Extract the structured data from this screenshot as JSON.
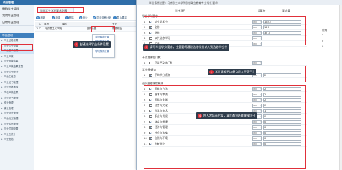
{
  "app": {
    "title": "毕业管理"
  },
  "sidebar": {
    "top": [
      "播教毕业管理",
      "我院毕业管理",
      "日常毕业管理"
    ],
    "section": "毕业管理",
    "items": [
      "毕业资格设置",
      "毕业学分设置",
      "毕业要求设置",
      "毕业审核",
      "毕业审核结果",
      "毕业审核结果查看",
      "毕业学分统计",
      "毕业生信息",
      "毕业证书管理",
      "学位资格审核",
      "学位审核结果",
      "学位证书管理",
      "结业管理",
      "肄业管理",
      "毕业设计管理",
      "毕业论文管理",
      "毕业成绩管理",
      "毕业学期设置",
      "毕业生统计",
      "毕业归档"
    ]
  },
  "main": {
    "tab": "毕业学生学分要求列表",
    "toolbar": [
      "刷新",
      "新增",
      "删除",
      "统计",
      "同步培养计划",
      "导入要求"
    ],
    "grid": {
      "headers": [
        "序号",
        "单位",
        "专业"
      ],
      "row": {
        "num": "1",
        "unit": "马克思主义学院",
        "action": "选择设置",
        "major": "思想政治"
      }
    },
    "context_menu": [
      "学分要求设置",
      "学分条件设置",
      "学分条件设置",
      "学分条件设置"
    ]
  },
  "dialog": {
    "title": "毕业条件设置：马克思主义学院思想政治教育专业 学分要求",
    "headers": [
      "毕业项目",
      "运算符",
      "要求值"
    ],
    "groups": [
      {
        "label": "学分学时要求",
        "rows": [
          {
            "idx": "1",
            "name": "毕业总学分",
            "op": ">=",
            "value": "164.5"
          },
          {
            "idx": "2",
            "name": "必修",
            "op": ">=",
            "value": "127"
          },
          {
            "idx": "3",
            "name": "选修",
            "op": ">=",
            "value": "37.5"
          },
          {
            "idx": "4",
            "name": "公共选修学分",
            "op": ">="
          },
          {
            "idx": "5",
            "name": "公选",
            "op": ">="
          }
        ]
      },
      {
        "label": "不及格课程门数",
        "rows": [
          {
            "idx": "1",
            "name": "正常不及格门数",
            "op": ">="
          }
        ]
      },
      {
        "label": "学分绩/绩点",
        "rows": [
          {
            "idx": "1",
            "name": "平均学分绩点",
            "op": ">=",
            "value": "2"
          }
        ]
      },
      {
        "label": "通识选修课程模块",
        "rows": [
          {
            "idx": "1",
            "name": "思维与方法",
            "op": ">=",
            "value": "2"
          },
          {
            "idx": "2",
            "name": "艺术与审美",
            "op": ">=",
            "value": "2"
          },
          {
            "idx": "3",
            "name": "国际与全球",
            "op": ">=",
            "value": "2"
          },
          {
            "idx": "4",
            "name": "语言与文化",
            "op": ">=",
            "value": "0"
          },
          {
            "idx": "5",
            "name": "科学与技术",
            "op": ">=",
            "value": "1"
          },
          {
            "idx": "6",
            "name": "职业与发展",
            "op": ">=",
            "value": "0"
          },
          {
            "idx": "7",
            "name": "体育与健康",
            "op": ">=",
            "value": "0"
          },
          {
            "idx": "8",
            "name": "经济与管理",
            "op": ">=",
            "value": "0"
          },
          {
            "idx": "9",
            "name": "社会与法律",
            "op": ">=",
            "value": "0"
          },
          {
            "idx": "10",
            "name": "自然与环境",
            "op": ">=",
            "value": "0"
          },
          {
            "idx": "11",
            "name": "创新创业",
            "op": ">=",
            "value": "0"
          }
        ]
      }
    ],
    "side": [
      "说明",
      "2",
      "0",
      "0"
    ]
  },
  "callouts": [
    {
      "num": "1",
      "text": "右键选择学业条件设置"
    },
    {
      "num": "2",
      "text": "填写毕业学分要求，注意要将通识选修学分纳入到选修学分中"
    },
    {
      "num": "3",
      "text": "学位课程平均绩点须大于等于2"
    },
    {
      "num": "4",
      "text": "按人才培养方案，填写通识选修课模块分"
    }
  ],
  "colors": {
    "accent": "#2f6ea9",
    "highlight": "#e0303a",
    "callout_bg": "#2f3d4c"
  }
}
